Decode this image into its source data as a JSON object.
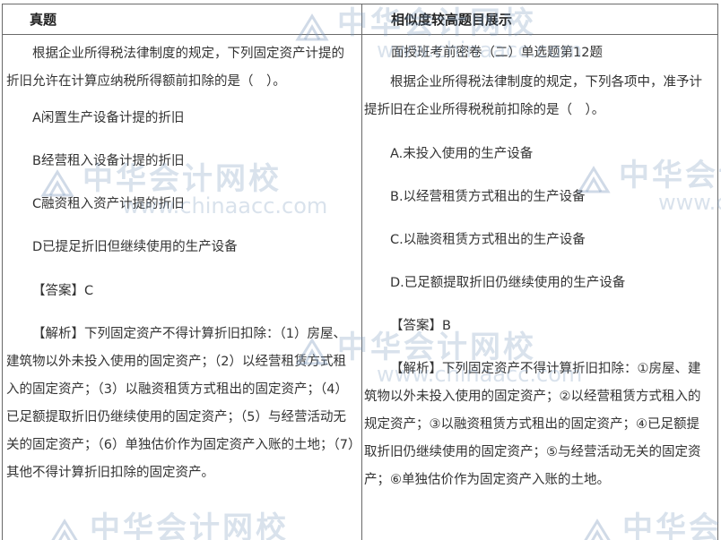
{
  "left": {
    "header": "真题",
    "question": "根据企业所得税法律制度的规定，下列固定资产计提的折旧允许在计算应纳税所得额前扣除的是（　）。",
    "options": [
      "A闲置生产设备计提的折旧",
      "B经营租入设备计提的折旧",
      "C融资租入资产计提的折旧",
      "D已提足折旧但继续使用的生产设备"
    ],
    "answer": "【答案】C",
    "explanation": "【解析】下列固定资产不得计算折旧扣除：（1）房屋、建筑物以外未投入使用的固定资产；（2）以经营租赁方式租入的固定资产；（3）以融资租赁方式租出的固定资产；（4）已足额提取折旧仍继续使用的固定资产；（5）与经营活动无关的固定资产；（6）单独估价作为固定资产入账的土地；（7）其他不得计算折旧扣除的固定资产。"
  },
  "right": {
    "header": "相似度较高题目展示",
    "source": "面授班考前密卷（二）单选题第12题",
    "question": "根据企业所得税法律制度的规定，下列各项中，准予计提折旧在企业所得税税前扣除的是（　）。",
    "options": [
      "A.未投入使用的生产设备",
      "B.以经营租赁方式租出的生产设备",
      "C.以融资租赁方式租出的生产设备",
      "D.已足额提取折旧仍继续使用的生产设备"
    ],
    "answer": "【答案】B",
    "explanation": "【解析】下列固定资产不得计算折旧扣除：①房屋、建筑物以外未投入使用的固定资产；②以经营租赁方式租入的规定资产；③以融资租赁方式租出的固定资产；④已足额提取折旧仍继续使用的固定资产；⑤与经营活动无关的固定资产；⑥单独估价作为固定资产入账的土地。"
  },
  "watermark": {
    "cn": "中华会计网校",
    "en": "www.chinaacc.com",
    "color": "#7896b9"
  }
}
